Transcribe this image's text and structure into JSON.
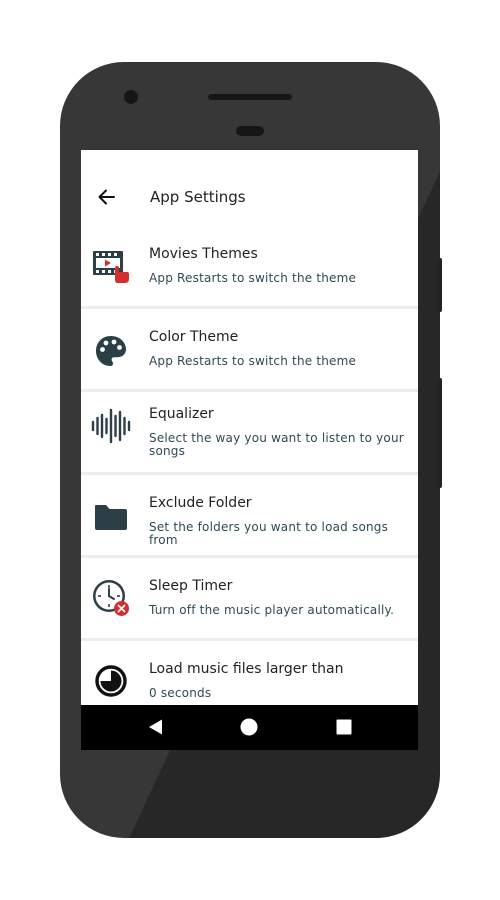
{
  "app_bar": {
    "title": "App Settings",
    "back_icon": "arrow-left-icon"
  },
  "settings": [
    {
      "title": "Movies Themes",
      "subtitle": "App Restarts to switch the theme",
      "icon": "movie-touch-icon"
    },
    {
      "title": "Color Theme",
      "subtitle": "App Restarts to switch the theme",
      "icon": "palette-icon"
    },
    {
      "title": "Equalizer",
      "subtitle": "Select the way you want to listen to your songs",
      "icon": "sound-wave-icon"
    },
    {
      "title": "Exclude Folder",
      "subtitle": "Set the folders you want to load songs from",
      "icon": "folder-icon"
    },
    {
      "title": "Sleep Timer",
      "subtitle": "Turn off the music player automatically.",
      "icon": "clock-timer-icon"
    },
    {
      "title": "Load music files larger than",
      "subtitle": "0 seconds",
      "icon": "timer-icon"
    }
  ],
  "nav_bar": {
    "back": "triangle-back-icon",
    "home": "circle-home-icon",
    "recents": "square-recents-icon"
  },
  "colors": {
    "icon_dark": "#2c3f46",
    "accent_red": "#d32f2f",
    "phone_body": "#2b2b2b",
    "subtitle": "#2f4a53"
  }
}
